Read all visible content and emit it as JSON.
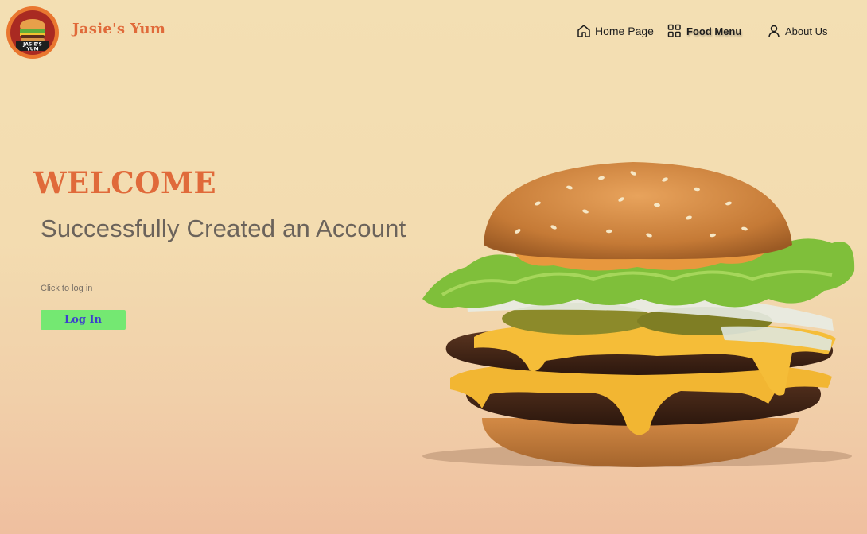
{
  "header": {
    "logo_text_line1": "JASIE'S",
    "logo_text_line2": "YUM",
    "brand": "Jasie's Yum"
  },
  "nav": {
    "home": "Home Page",
    "food_menu": "Food Menu",
    "about": "About Us"
  },
  "main": {
    "welcome": "WELCOME",
    "subtitle": "Successfully Created an Account",
    "hint": "Click to log in",
    "login_label": "Log In"
  },
  "icons": {
    "home": "home-icon",
    "menu": "grid-icon",
    "about": "user-icon"
  },
  "colors": {
    "brand": "#e06a3a",
    "button": "#74e872",
    "button_text": "#3c3fcd"
  }
}
